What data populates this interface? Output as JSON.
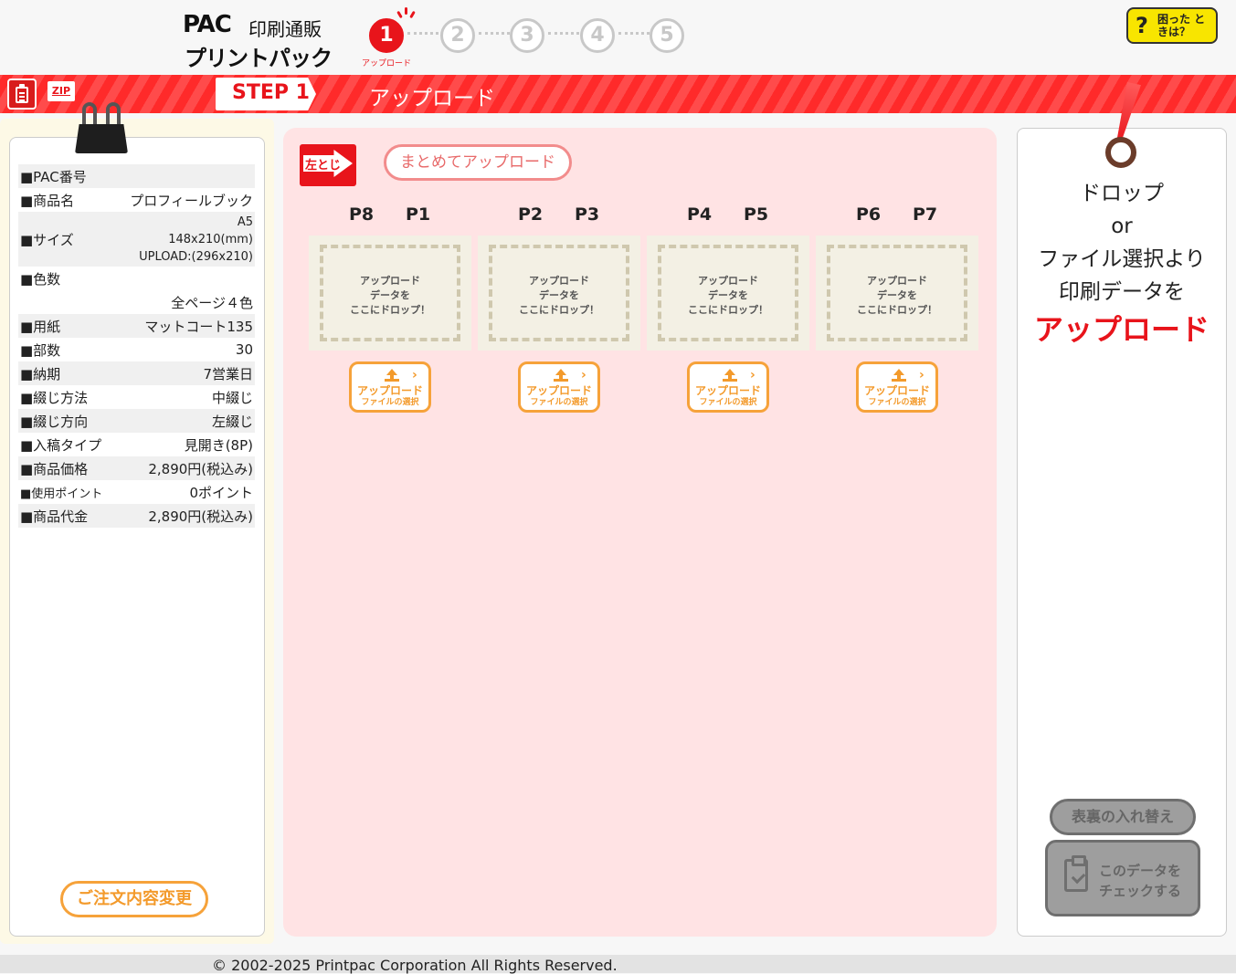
{
  "header": {
    "logo_pac": "PAC",
    "logo_sub": "印刷通販",
    "logo_main": "プリントパック",
    "steps": [
      "1",
      "2",
      "3",
      "4",
      "5"
    ],
    "active_step_caption": "アップロード",
    "help_label": "困った ときは？",
    "help_mark": "?"
  },
  "stepbar": {
    "zip_label": "ZIP",
    "step_badge": "STEP 1",
    "title": "アップロード"
  },
  "order_info": {
    "rows": [
      {
        "key": "■PAC番号",
        "value": ""
      },
      {
        "key": "■商品名",
        "value": "プロフィールブック"
      },
      {
        "key": "■サイズ",
        "value_lines": [
          "A5",
          "148x210(mm)",
          "UPLOAD:(296x210)"
        ]
      },
      {
        "key": "■色数",
        "value": ""
      },
      {
        "key": "",
        "value": "全ページ４色"
      },
      {
        "key": "■用紙",
        "value": "マットコート135"
      },
      {
        "key": "■部数",
        "value": "30"
      },
      {
        "key": "■納期",
        "value": "7営業日"
      },
      {
        "key": "■綴じ方法",
        "value": "中綴じ"
      },
      {
        "key": "■綴じ方向",
        "value": "左綴じ"
      },
      {
        "key": "■入稿タイプ",
        "value": "見開き(8P)"
      },
      {
        "key": "■商品価格",
        "value": "2,890円(税込み)"
      },
      {
        "key": "■使用ポイント",
        "value": "0ポイント"
      },
      {
        "key": "■商品代金",
        "value": "2,890円(税込み)"
      }
    ],
    "order_change_label": "ご注文内容変更"
  },
  "upload": {
    "binding_label": "左とじ",
    "bulk_upload_label": "まとめてアップロード",
    "drop_text": [
      "アップロード",
      "データを",
      "ここにドロップ！"
    ],
    "file_button_line1": "アップロード",
    "file_button_line2": "ファイルの選択",
    "file_button_chevron": "›",
    "spreads": [
      {
        "left": "P8",
        "right": "P1"
      },
      {
        "left": "P2",
        "right": "P3"
      },
      {
        "left": "P4",
        "right": "P5"
      },
      {
        "left": "P6",
        "right": "P7"
      }
    ]
  },
  "right": {
    "line1": "ドロップ",
    "line2": "or",
    "line3": "ファイル選択より",
    "line4": "印刷データを",
    "line5": "アップロード",
    "swap_label": "表裏の入れ替え",
    "check_label_1": "このデータを",
    "check_label_2": "チェックする"
  },
  "footer": {
    "copyright": "© 2002-2025 Printpac Corporation All Rights Reserved."
  },
  "colors": {
    "brand_red": "#e8141b",
    "accent_orange": "#f39a2b",
    "panel_pink": "#ffe3e4",
    "help_yellow": "#f8e500"
  }
}
